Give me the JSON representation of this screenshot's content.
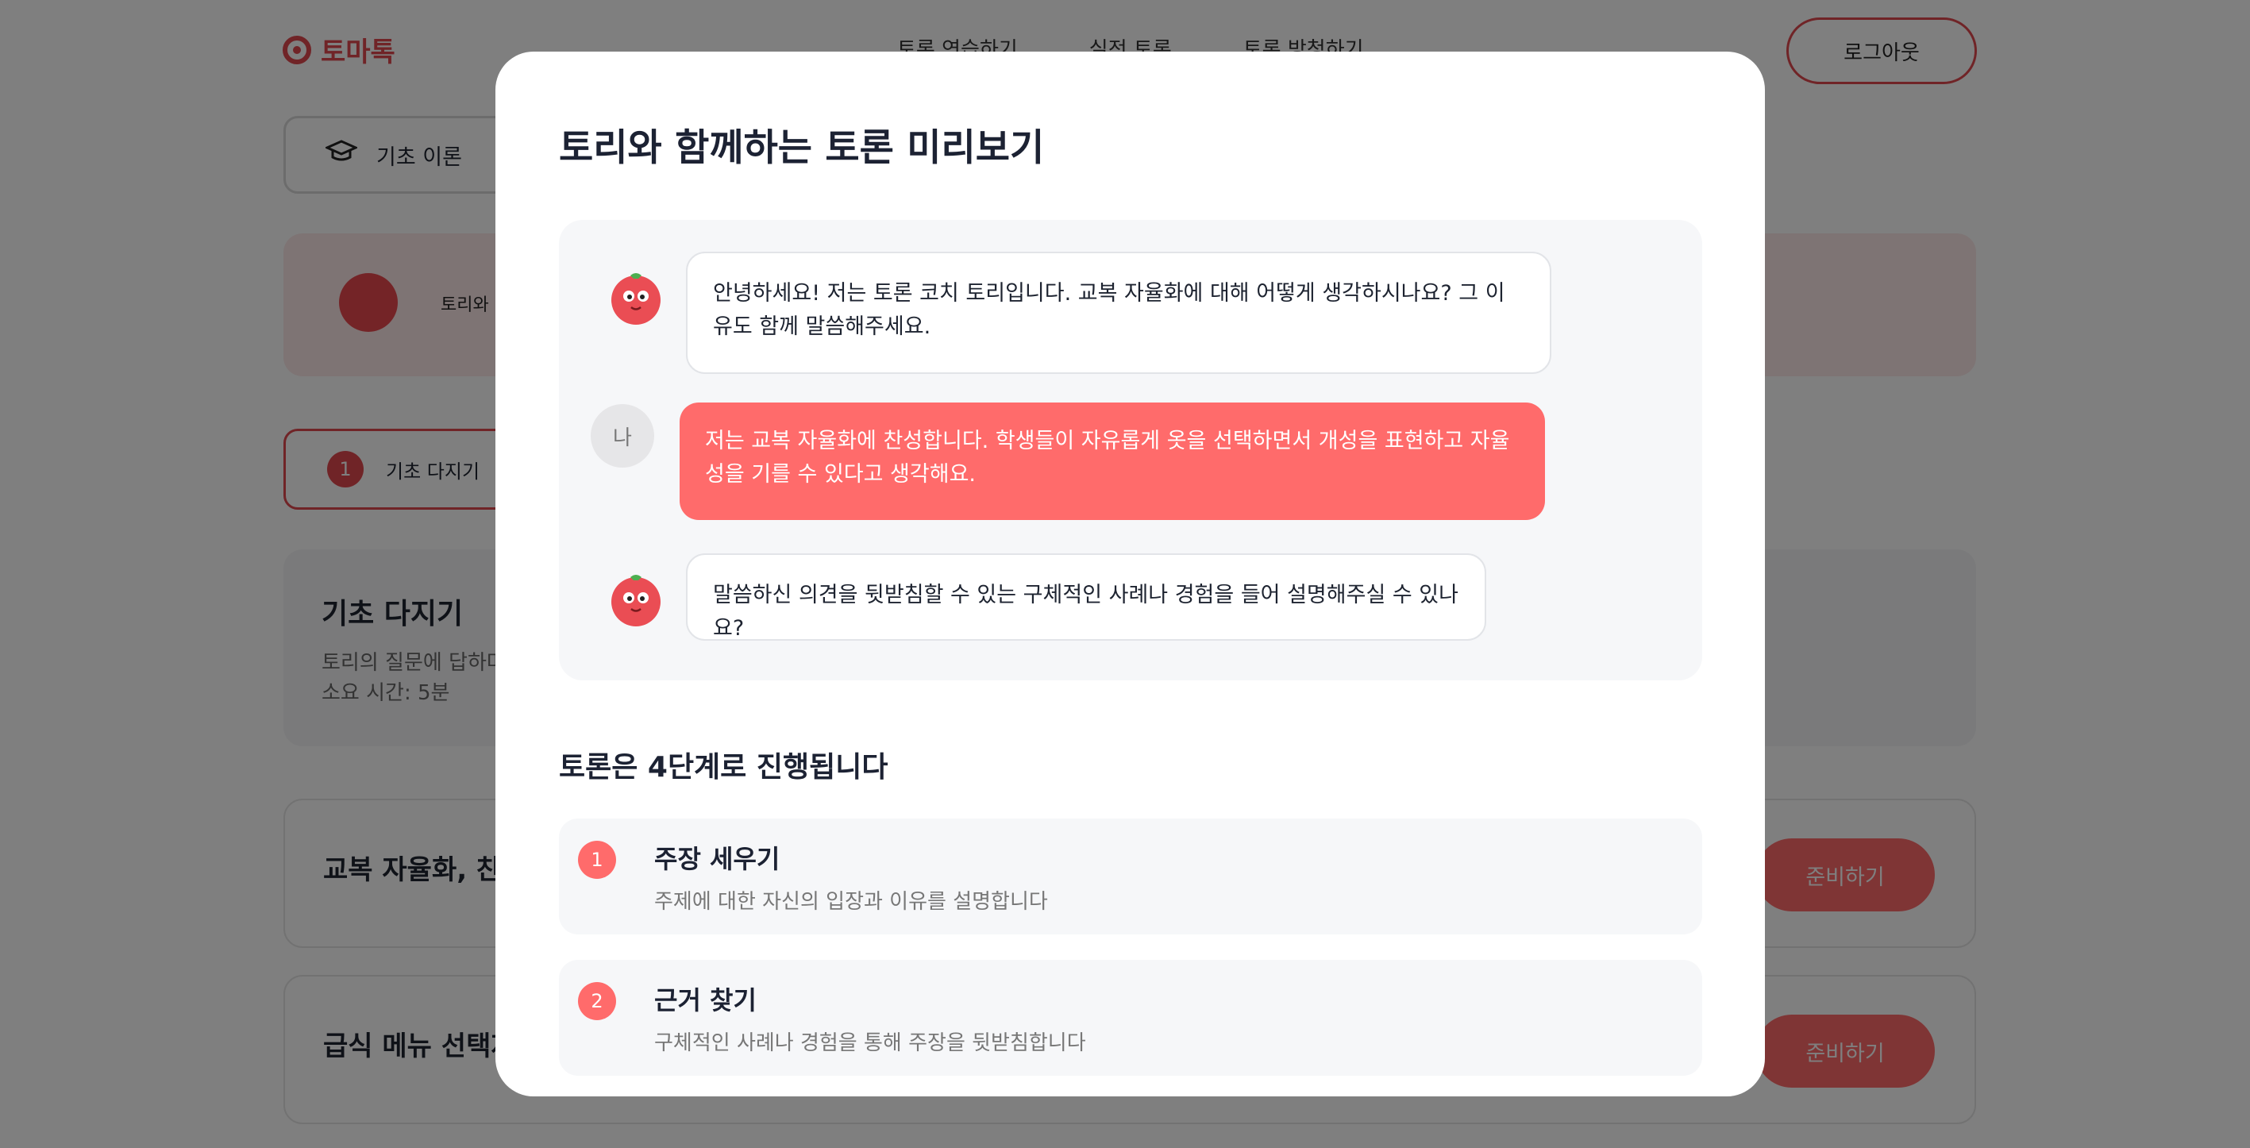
{
  "brand": {
    "name": "토마톡"
  },
  "nav": {
    "items": [
      "토론 연습하기",
      "실전 토론",
      "토론 방청하기"
    ],
    "logout_label": "로그아웃"
  },
  "tabs": {
    "basic_theory": "기초 이론"
  },
  "banner": {
    "text": "토리와"
  },
  "step_chip": {
    "number": "1",
    "label": "기초 다지기"
  },
  "step_card": {
    "title": "기초 다지기",
    "description": "토리의 질문에 답하며",
    "time": "소요 시간: 5분"
  },
  "topics": [
    {
      "title": "교복 자율화, 찬성",
      "button": "준비하기"
    },
    {
      "title": "급식 메뉴 선택제",
      "button": "준비하기"
    }
  ],
  "modal": {
    "title": "토리와 함께하는 토론 미리보기",
    "chat": [
      {
        "sender": "bot",
        "text": "안녕하세요! 저는 토론 코치 토리입니다. 교복 자율화에 대해 어떻게 생각하시나요? 그 이유도 함께 말씀해주세요."
      },
      {
        "sender": "me",
        "avatar": "나",
        "text": "저는 교복 자율화에 찬성합니다. 학생들이 자유롭게 옷을 선택하면서 개성을 표현하고 자율성을 기를 수 있다고 생각해요."
      },
      {
        "sender": "bot",
        "text": "말씀하신 의견을 뒷받침할 수 있는 구체적인 사례나 경험을 들어 설명해주실 수 있나요?"
      }
    ],
    "steps_heading": "토론은 4단계로 진행됩니다",
    "steps": [
      {
        "number": "1",
        "name": "주장 세우기",
        "desc": "주제에 대한 자신의 입장과 이유를 설명합니다"
      },
      {
        "number": "2",
        "name": "근거 찾기",
        "desc": "구체적인 사례나 경험을 통해 주장을 뒷받침합니다"
      }
    ]
  },
  "colors": {
    "accent": "#ff6b6b",
    "brand": "#e0484f",
    "overlay": "rgba(0,0,0,0.5)"
  }
}
